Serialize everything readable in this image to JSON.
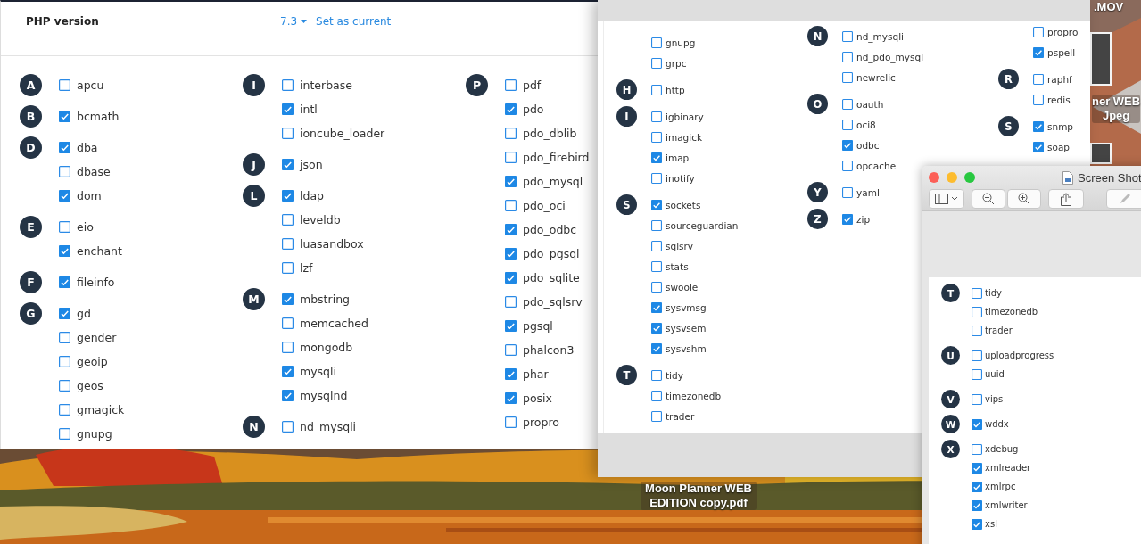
{
  "desktop": {
    "kind": "picture",
    "file_labels": [
      {
        "lines": [
          ".MOV"
        ]
      },
      {
        "lines": [
          "ner WEB",
          "Jpeg"
        ]
      },
      {
        "lines": [
          "Moon Planner WEB",
          "EDITION copy.pdf"
        ]
      }
    ]
  },
  "extensions_page": {
    "title": "PHP version",
    "version": "7.3",
    "action": "Set as current",
    "columns": [
      {
        "groups": [
          {
            "letter": "A",
            "items": [
              {
                "name": "apcu",
                "checked": false
              }
            ]
          },
          {
            "letter": "B",
            "items": [
              {
                "name": "bcmath",
                "checked": true
              }
            ]
          },
          {
            "letter": "D",
            "items": [
              {
                "name": "dba",
                "checked": true
              },
              {
                "name": "dbase",
                "checked": false
              },
              {
                "name": "dom",
                "checked": true
              }
            ]
          },
          {
            "letter": "E",
            "items": [
              {
                "name": "eio",
                "checked": false
              },
              {
                "name": "enchant",
                "checked": true
              }
            ]
          },
          {
            "letter": "F",
            "items": [
              {
                "name": "fileinfo",
                "checked": true
              }
            ]
          },
          {
            "letter": "G",
            "items": [
              {
                "name": "gd",
                "checked": true
              },
              {
                "name": "gender",
                "checked": false
              },
              {
                "name": "geoip",
                "checked": false
              },
              {
                "name": "geos",
                "checked": false
              },
              {
                "name": "gmagick",
                "checked": false
              },
              {
                "name": "gnupg",
                "checked": false
              }
            ]
          }
        ]
      },
      {
        "groups": [
          {
            "letter": "I",
            "items": [
              {
                "name": "interbase",
                "checked": false
              },
              {
                "name": "intl",
                "checked": true
              },
              {
                "name": "ioncube_loader",
                "checked": false
              }
            ]
          },
          {
            "letter": "J",
            "items": [
              {
                "name": "json",
                "checked": true
              }
            ]
          },
          {
            "letter": "L",
            "items": [
              {
                "name": "ldap",
                "checked": true
              },
              {
                "name": "leveldb",
                "checked": false
              },
              {
                "name": "luasandbox",
                "checked": false
              },
              {
                "name": "lzf",
                "checked": false
              }
            ]
          },
          {
            "letter": "M",
            "items": [
              {
                "name": "mbstring",
                "checked": true
              },
              {
                "name": "memcached",
                "checked": false
              },
              {
                "name": "mongodb",
                "checked": false
              },
              {
                "name": "mysqli",
                "checked": true
              },
              {
                "name": "mysqlnd",
                "checked": true
              }
            ]
          },
          {
            "letter": "N",
            "items": [
              {
                "name": "nd_mysqli",
                "checked": false
              }
            ]
          }
        ]
      },
      {
        "groups": [
          {
            "letter": "P",
            "items": [
              {
                "name": "pdf",
                "checked": false
              },
              {
                "name": "pdo",
                "checked": true
              },
              {
                "name": "pdo_dblib",
                "checked": false
              },
              {
                "name": "pdo_firebird",
                "checked": false
              },
              {
                "name": "pdo_mysql",
                "checked": true
              },
              {
                "name": "pdo_oci",
                "checked": false
              },
              {
                "name": "pdo_odbc",
                "checked": true
              },
              {
                "name": "pdo_pgsql",
                "checked": true
              },
              {
                "name": "pdo_sqlite",
                "checked": true
              },
              {
                "name": "pdo_sqlsrv",
                "checked": false
              },
              {
                "name": "pgsql",
                "checked": true
              },
              {
                "name": "phalcon3",
                "checked": false
              },
              {
                "name": "phar",
                "checked": true
              },
              {
                "name": "posix",
                "checked": true
              },
              {
                "name": "propro",
                "checked": false
              }
            ]
          }
        ]
      }
    ]
  },
  "screenshot_window": {
    "columns": [
      {
        "groups": [
          {
            "items": [
              {
                "name": "gnupg",
                "checked": false
              },
              {
                "name": "grpc",
                "checked": false
              }
            ]
          },
          {
            "letter": "H",
            "items": [
              {
                "name": "http",
                "checked": false
              }
            ]
          },
          {
            "letter": "I",
            "items": [
              {
                "name": "igbinary",
                "checked": false
              },
              {
                "name": "imagick",
                "checked": false
              },
              {
                "name": "imap",
                "checked": true
              },
              {
                "name": "inotify",
                "checked": false
              }
            ]
          },
          {
            "letter": "S",
            "items": [
              {
                "name": "sockets",
                "checked": true
              },
              {
                "name": "sourceguardian",
                "checked": false
              },
              {
                "name": "sqlsrv",
                "checked": false
              },
              {
                "name": "stats",
                "checked": false
              },
              {
                "name": "swoole",
                "checked": false
              },
              {
                "name": "sysvmsg",
                "checked": true
              },
              {
                "name": "sysvsem",
                "checked": true
              },
              {
                "name": "sysvshm",
                "checked": true
              }
            ]
          },
          {
            "letter": "T",
            "items": [
              {
                "name": "tidy",
                "checked": false
              },
              {
                "name": "timezonedb",
                "checked": false
              },
              {
                "name": "trader",
                "checked": false
              }
            ]
          }
        ]
      },
      {
        "groups": [
          {
            "letter": "N",
            "items": [
              {
                "name": "nd_mysqli",
                "checked": false
              },
              {
                "name": "nd_pdo_mysql",
                "checked": false
              },
              {
                "name": "newrelic",
                "checked": false
              }
            ]
          },
          {
            "letter": "O",
            "items": [
              {
                "name": "oauth",
                "checked": false
              },
              {
                "name": "oci8",
                "checked": false
              },
              {
                "name": "odbc",
                "checked": true
              },
              {
                "name": "opcache",
                "checked": false
              }
            ]
          },
          {
            "letter": "Y",
            "items": [
              {
                "name": "yaml",
                "checked": false
              }
            ]
          },
          {
            "letter": "Z",
            "items": [
              {
                "name": "zip",
                "checked": true
              }
            ]
          }
        ]
      },
      {
        "groups": [
          {
            "items": [
              {
                "name": "propro",
                "checked": false
              },
              {
                "name": "pspell",
                "checked": true
              }
            ]
          },
          {
            "letter": "R",
            "items": [
              {
                "name": "raphf",
                "checked": false
              },
              {
                "name": "redis",
                "checked": false
              }
            ]
          },
          {
            "letter": "S",
            "items": [
              {
                "name": "snmp",
                "checked": true
              },
              {
                "name": "soap",
                "checked": true
              }
            ]
          }
        ]
      }
    ]
  },
  "preview_window": {
    "title": "Screen Shot",
    "columns": [
      {
        "groups": [
          {
            "letter": "T",
            "items": [
              {
                "name": "tidy",
                "checked": false
              },
              {
                "name": "timezonedb",
                "checked": false
              },
              {
                "name": "trader",
                "checked": false
              }
            ]
          },
          {
            "letter": "U",
            "items": [
              {
                "name": "uploadprogress",
                "checked": false
              },
              {
                "name": "uuid",
                "checked": false
              }
            ]
          },
          {
            "letter": "V",
            "items": [
              {
                "name": "vips",
                "checked": false
              }
            ]
          },
          {
            "letter": "W",
            "items": [
              {
                "name": "wddx",
                "checked": true
              }
            ]
          },
          {
            "letter": "X",
            "items": [
              {
                "name": "xdebug",
                "checked": false
              },
              {
                "name": "xmlreader",
                "checked": true
              },
              {
                "name": "xmlrpc",
                "checked": true
              },
              {
                "name": "xmlwriter",
                "checked": true
              },
              {
                "name": "xsl",
                "checked": true
              }
            ]
          }
        ]
      }
    ]
  }
}
